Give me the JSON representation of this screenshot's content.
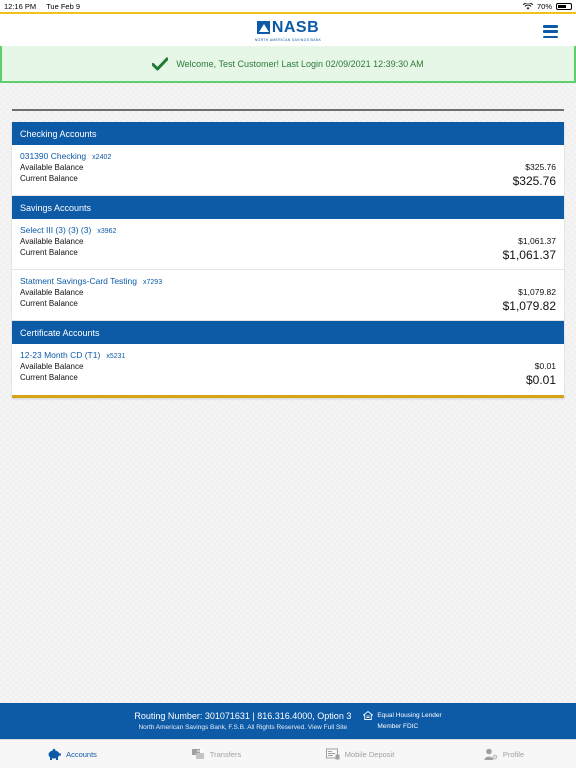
{
  "status_bar": {
    "time": "12:16 PM",
    "date": "Tue Feb 9",
    "battery": "70%",
    "battery_level": 0.7
  },
  "header": {
    "logo_text": "NASB",
    "logo_sub": "NORTH AMERICAN SAVINGS BANK"
  },
  "welcome": {
    "message": "Welcome, Test Customer! Last Login 02/09/2021 12:39:30 AM"
  },
  "sections": [
    {
      "title": "Checking Accounts",
      "accounts": [
        {
          "name": "031390 Checking",
          "mask": "x2402",
          "available_label": "Available Balance",
          "current_label": "Current Balance",
          "available": "$325.76",
          "current": "$325.76"
        }
      ]
    },
    {
      "title": "Savings Accounts",
      "accounts": [
        {
          "name": "Select III (3) (3) (3)",
          "mask": "x3962",
          "available_label": "Available Balance",
          "current_label": "Current Balance",
          "available": "$1,061.37",
          "current": "$1,061.37"
        },
        {
          "name": "Statment Savings-Card Testing",
          "mask": "x7293",
          "available_label": "Available Balance",
          "current_label": "Current Balance",
          "available": "$1,079.82",
          "current": "$1,079.82"
        }
      ]
    },
    {
      "title": "Certificate Accounts",
      "accounts": [
        {
          "name": "12-23 Month CD (T1)",
          "mask": "x5231",
          "available_label": "Available Balance",
          "current_label": "Current Balance",
          "available": "$0.01",
          "current": "$0.01"
        }
      ]
    }
  ],
  "footer": {
    "routing": "Routing Number: 301071631  |  816.316.4000, Option 3",
    "legal": "North American Savings Bank, F.S.B. All Rights Reserved. View Full Site",
    "equal_housing": "Equal Housing Lender",
    "fdic": "Member FDIC"
  },
  "tabs": [
    {
      "label": "Accounts",
      "icon": "piggy-bank-icon",
      "active": true
    },
    {
      "label": "Transfers",
      "icon": "transfer-icon",
      "active": false
    },
    {
      "label": "Mobile Deposit",
      "icon": "check-deposit-icon",
      "active": false
    },
    {
      "label": "Profile",
      "icon": "profile-gear-icon",
      "active": false
    }
  ],
  "colors": {
    "brand_blue": "#0d5aa7",
    "gold": "#f2c21b",
    "success_green": "#5fcf6d"
  }
}
